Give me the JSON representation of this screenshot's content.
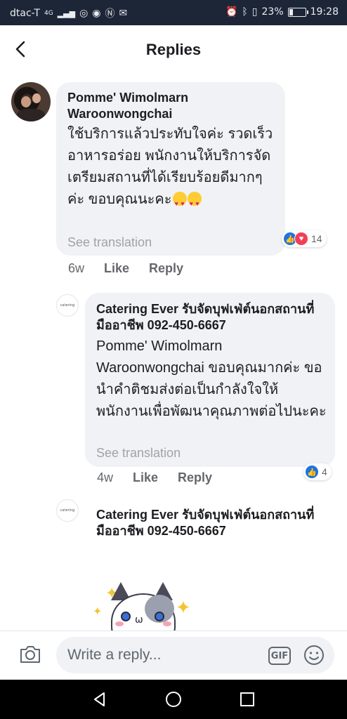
{
  "status_bar": {
    "carrier": "dtac-T",
    "network": "4G",
    "battery": "23%",
    "time": "19:28"
  },
  "header": {
    "title": "Replies"
  },
  "comments": [
    {
      "author": "Pomme' Wimolmarn Waroonwongchai",
      "text": "ใช้บริการแล้วประทับใจค่ะ รวดเร็ว อาหารอร่อย พนักงานให้บริการจัดเตรียมสถานที่ได้เรียบร้อยดีมากๆค่ะ ขอบคุณนะคะ",
      "see_translation": "See translation",
      "reaction_count": "14",
      "time": "6w",
      "like": "Like",
      "reply": "Reply"
    },
    {
      "author": "Catering Ever รับจัดบุฟเฟ่ต์นอกสถานที่มืออาชีพ 092-450-6667",
      "text": "Pomme' Wimolmarn Waroonwongchai ขอบคุณมากค่ะ ขอนำคำติชมส่งต่อเป็นกำลังใจให้พนักงานเพื่อพัฒนาคุณภาพต่อไปนะคะ",
      "see_translation": "See translation",
      "reaction_count": "4",
      "time": "4w",
      "like": "Like",
      "reply": "Reply"
    },
    {
      "author": "Catering Ever รับจัดบุฟเฟ่ต์นอกสถานที่มืออาชีพ 092-450-6667"
    }
  ],
  "composer": {
    "placeholder": "Write a reply...",
    "gif_label": "GIF"
  },
  "icons": {
    "back": "chevron-left-icon",
    "camera": "camera-icon",
    "emoji": "smiley-icon",
    "like_reaction": "thumbs-up-icon",
    "love_reaction": "heart-icon"
  },
  "colors": {
    "status_bar_bg": "#1d2637",
    "bubble_bg": "#f0f2f5",
    "like_blue": "#1b74e4",
    "love_red": "#f33e58",
    "muted_text": "#65676b"
  }
}
